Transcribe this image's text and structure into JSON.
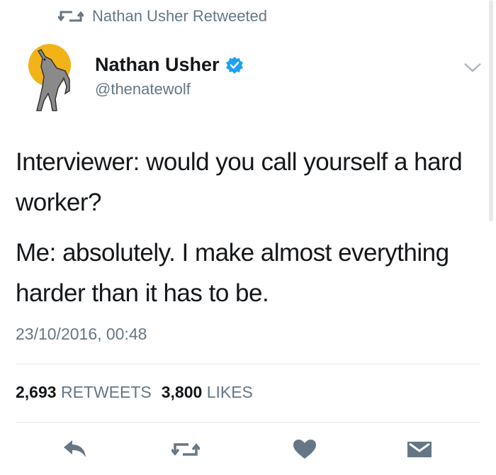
{
  "retweet_context": {
    "text": "Nathan Usher Retweeted",
    "icon": "retweet-icon"
  },
  "author": {
    "name": "Nathan Usher",
    "handle": "@thenatewolf",
    "verified": true,
    "avatar": "howling-wolf-moon-avatar"
  },
  "tweet": {
    "paragraphs": [
      "Interviewer: would you call yourself a hard worker?",
      "Me: absolutely. I make almost everything harder than it has to be."
    ],
    "timestamp": "23/10/2016, 00:48"
  },
  "stats": {
    "retweets_count": "2,693",
    "retweets_label": "RETWEETS",
    "likes_count": "3,800",
    "likes_label": "LIKES"
  },
  "actions": [
    "reply-icon",
    "retweet-icon",
    "like-icon",
    "direct-message-icon"
  ],
  "colors": {
    "text": "#14171a",
    "muted": "#657786",
    "verified": "#1da1f2",
    "icon": "#657786",
    "divider": "#e1e8ed"
  }
}
